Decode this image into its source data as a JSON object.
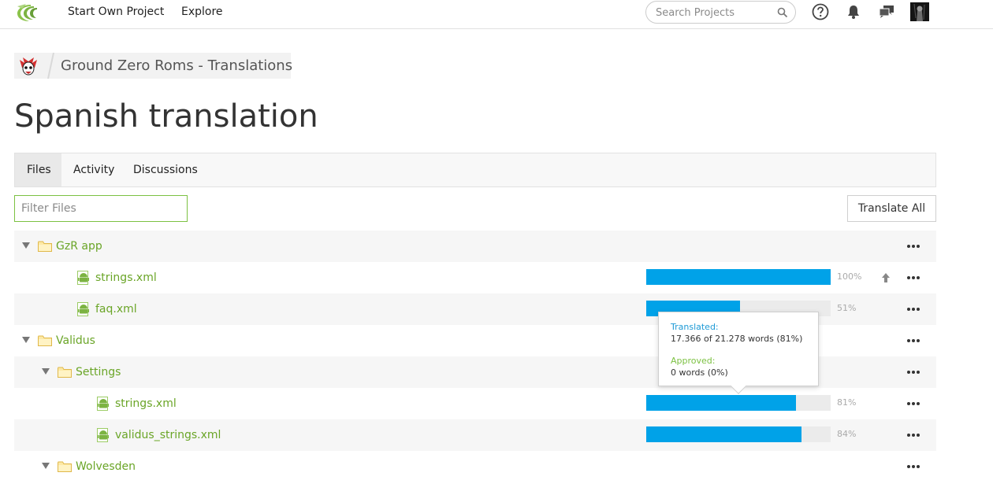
{
  "header": {
    "nav": [
      "Start Own Project",
      "Explore"
    ],
    "search_placeholder": "Search Projects",
    "icons": [
      "help-icon",
      "bell-icon",
      "chat-icon"
    ]
  },
  "breadcrumb": {
    "project": "Ground Zero Roms - Translations"
  },
  "page_title": "Spanish translation",
  "tabs": [
    "Files",
    "Activity",
    "Discussions"
  ],
  "active_tab": "Files",
  "filter_placeholder": "Filter Files",
  "translate_all_label": "Translate All",
  "tree": [
    {
      "type": "folder",
      "name": "GzR app",
      "level": 0
    },
    {
      "type": "file",
      "name": "strings.xml",
      "level": 1,
      "progress": 100,
      "pct_label": "100%",
      "upload": true
    },
    {
      "type": "file",
      "name": "faq.xml",
      "level": 1,
      "progress": 51,
      "pct_label": "51%"
    },
    {
      "type": "folder",
      "name": "Validus",
      "level": 0
    },
    {
      "type": "folder",
      "name": "Settings",
      "level": 1
    },
    {
      "type": "file",
      "name": "strings.xml",
      "level": 2,
      "progress": 81,
      "pct_label": "81%"
    },
    {
      "type": "file",
      "name": "validus_strings.xml",
      "level": 2,
      "progress": 84,
      "pct_label": "84%"
    },
    {
      "type": "folder",
      "name": "Wolvesden",
      "level": 1
    }
  ],
  "tooltip": {
    "translated_label": "Translated:",
    "translated_value": "17.366 of 21.278 words (81%)",
    "approved_label": "Approved:",
    "approved_value": "0 words (0%)"
  },
  "colors": {
    "brand_green": "#6aa527",
    "progress_blue": "#00a2e8",
    "translated_label": "#1d9ad6",
    "approved_label": "#7cc142"
  }
}
